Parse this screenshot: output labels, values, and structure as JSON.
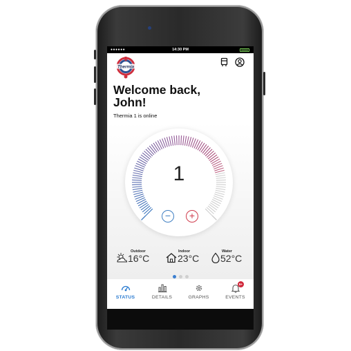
{
  "status_bar": {
    "signal": "●●●●●●",
    "time": "14:30 PM"
  },
  "header": {
    "logo_text": "Thermia"
  },
  "welcome": {
    "title_line1": "Welcome back,",
    "title_line2": "John!",
    "subtitle": "Thermia 1 is online"
  },
  "gauge": {
    "value": "1",
    "level": 0.5,
    "minus_label": "−",
    "plus_label": "+"
  },
  "readings": [
    {
      "label": "Outdoor",
      "value": "16°C",
      "icon": "sun-cloud-icon"
    },
    {
      "label": "Indoor",
      "value": "23°C",
      "icon": "house-icon"
    },
    {
      "label": "Water",
      "value": "52°C",
      "icon": "droplet-icon"
    }
  ],
  "pager": {
    "pages": 3,
    "active": 0
  },
  "tabs": [
    {
      "label": "STATUS",
      "icon": "gauge-icon",
      "active": true
    },
    {
      "label": "DETAILS",
      "icon": "bar-chart-icon",
      "active": false
    },
    {
      "label": "GRAPHS",
      "icon": "gear-icon",
      "active": false
    },
    {
      "label": "EVENTS",
      "icon": "bell-icon",
      "active": false,
      "badge": "9+"
    }
  ],
  "colors": {
    "accent_blue": "#2a7bd0",
    "accent_red": "#cf3b4c",
    "badge_red": "#d0273a",
    "battery_green": "#7cd35a"
  }
}
